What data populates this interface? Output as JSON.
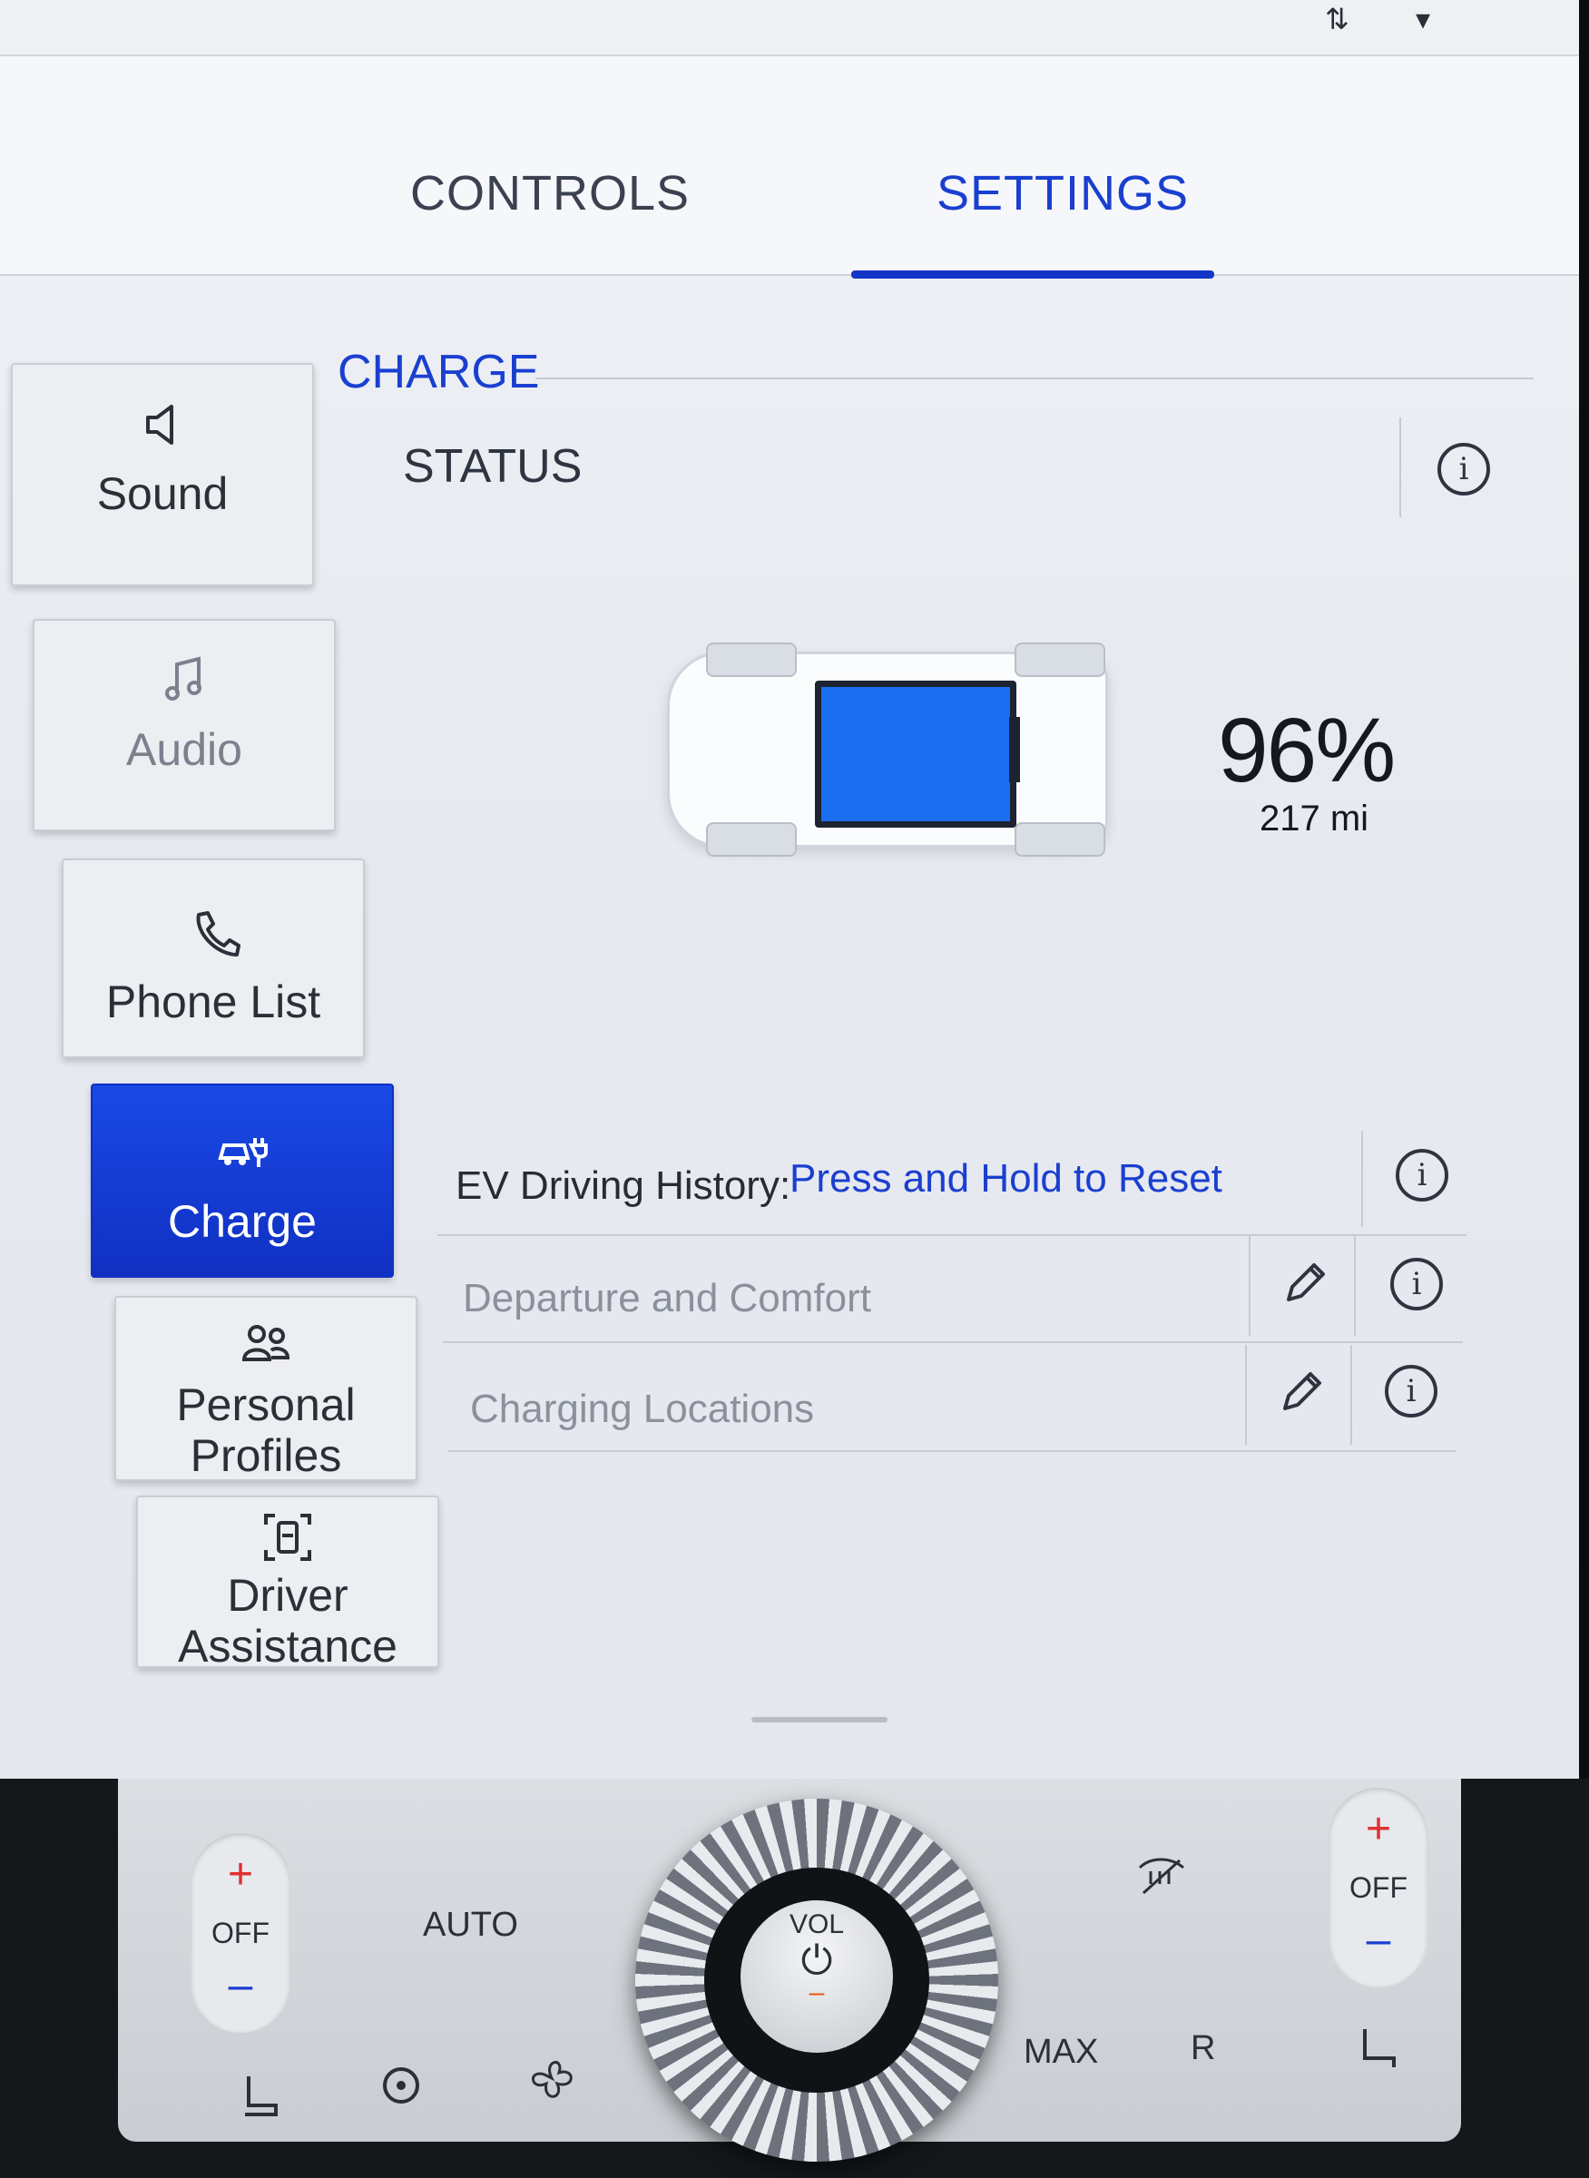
{
  "tabs": [
    {
      "label": "CONTROLS",
      "active": false
    },
    {
      "label": "SETTINGS",
      "active": true
    }
  ],
  "nav": {
    "items": [
      {
        "label": "Sound",
        "icon": "speaker-icon"
      },
      {
        "label": "Audio",
        "icon": "music-note-icon"
      },
      {
        "label": "Phone List",
        "icon": "phone-icon"
      },
      {
        "label": "Charge",
        "icon": "ev-charge-icon",
        "active": true
      },
      {
        "label_line1": "Personal",
        "label_line2": "Profiles",
        "icon": "people-icon"
      },
      {
        "label_line1": "Driver",
        "label_line2": "Assistance",
        "icon": "driver-assist-icon"
      }
    ]
  },
  "section": {
    "title": "CHARGE",
    "status_label": "STATUS"
  },
  "battery": {
    "percent": "96%",
    "range": "217 mi",
    "level": 0.96,
    "fill_color": "#1b6ef0"
  },
  "rows": [
    {
      "label": "EV Driving History:",
      "link": "Press and Hold to Reset"
    },
    {
      "label": "Departure and Comfort"
    },
    {
      "label": "Charging Locations"
    }
  ],
  "climate": {
    "left_temp": {
      "plus": "+",
      "off": "OFF",
      "minus": "–"
    },
    "auto": "AUTO",
    "knob": {
      "vol": "VOL",
      "power": "⏻",
      "dash": "–"
    },
    "max": "MAX",
    "rear": "R",
    "right_temp": {
      "plus": "+",
      "off": "OFF",
      "minus": "–"
    }
  },
  "colors": {
    "accent": "#1a3fd0",
    "active_nav": "#1436c8"
  }
}
